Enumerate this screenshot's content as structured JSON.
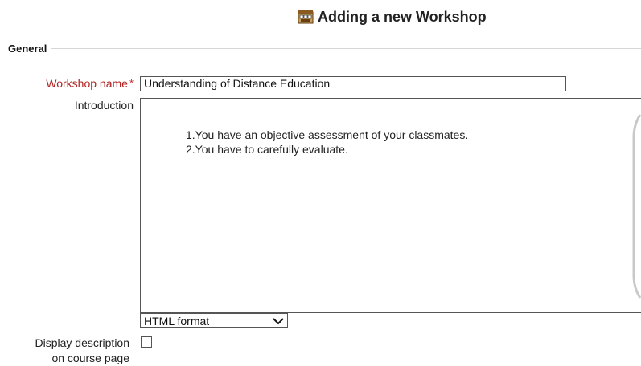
{
  "header": {
    "title": "Adding a new Workshop",
    "icon": "workshop-icon"
  },
  "section": {
    "legend": "General"
  },
  "fields": {
    "workshop_name": {
      "label": "Workshop name",
      "required_marker": "*",
      "value": "Understanding of Distance Education"
    },
    "introduction": {
      "label": "Introduction",
      "content": [
        "1.You have an objective assessment of your classmates.",
        "2.You have to carefully evaluate."
      ]
    },
    "format": {
      "selected": "HTML format"
    },
    "display_description": {
      "label_line1": "Display description",
      "label_line2": "on course page",
      "checked": false
    }
  },
  "colors": {
    "required_label": "#b22222",
    "border": "#555555"
  }
}
